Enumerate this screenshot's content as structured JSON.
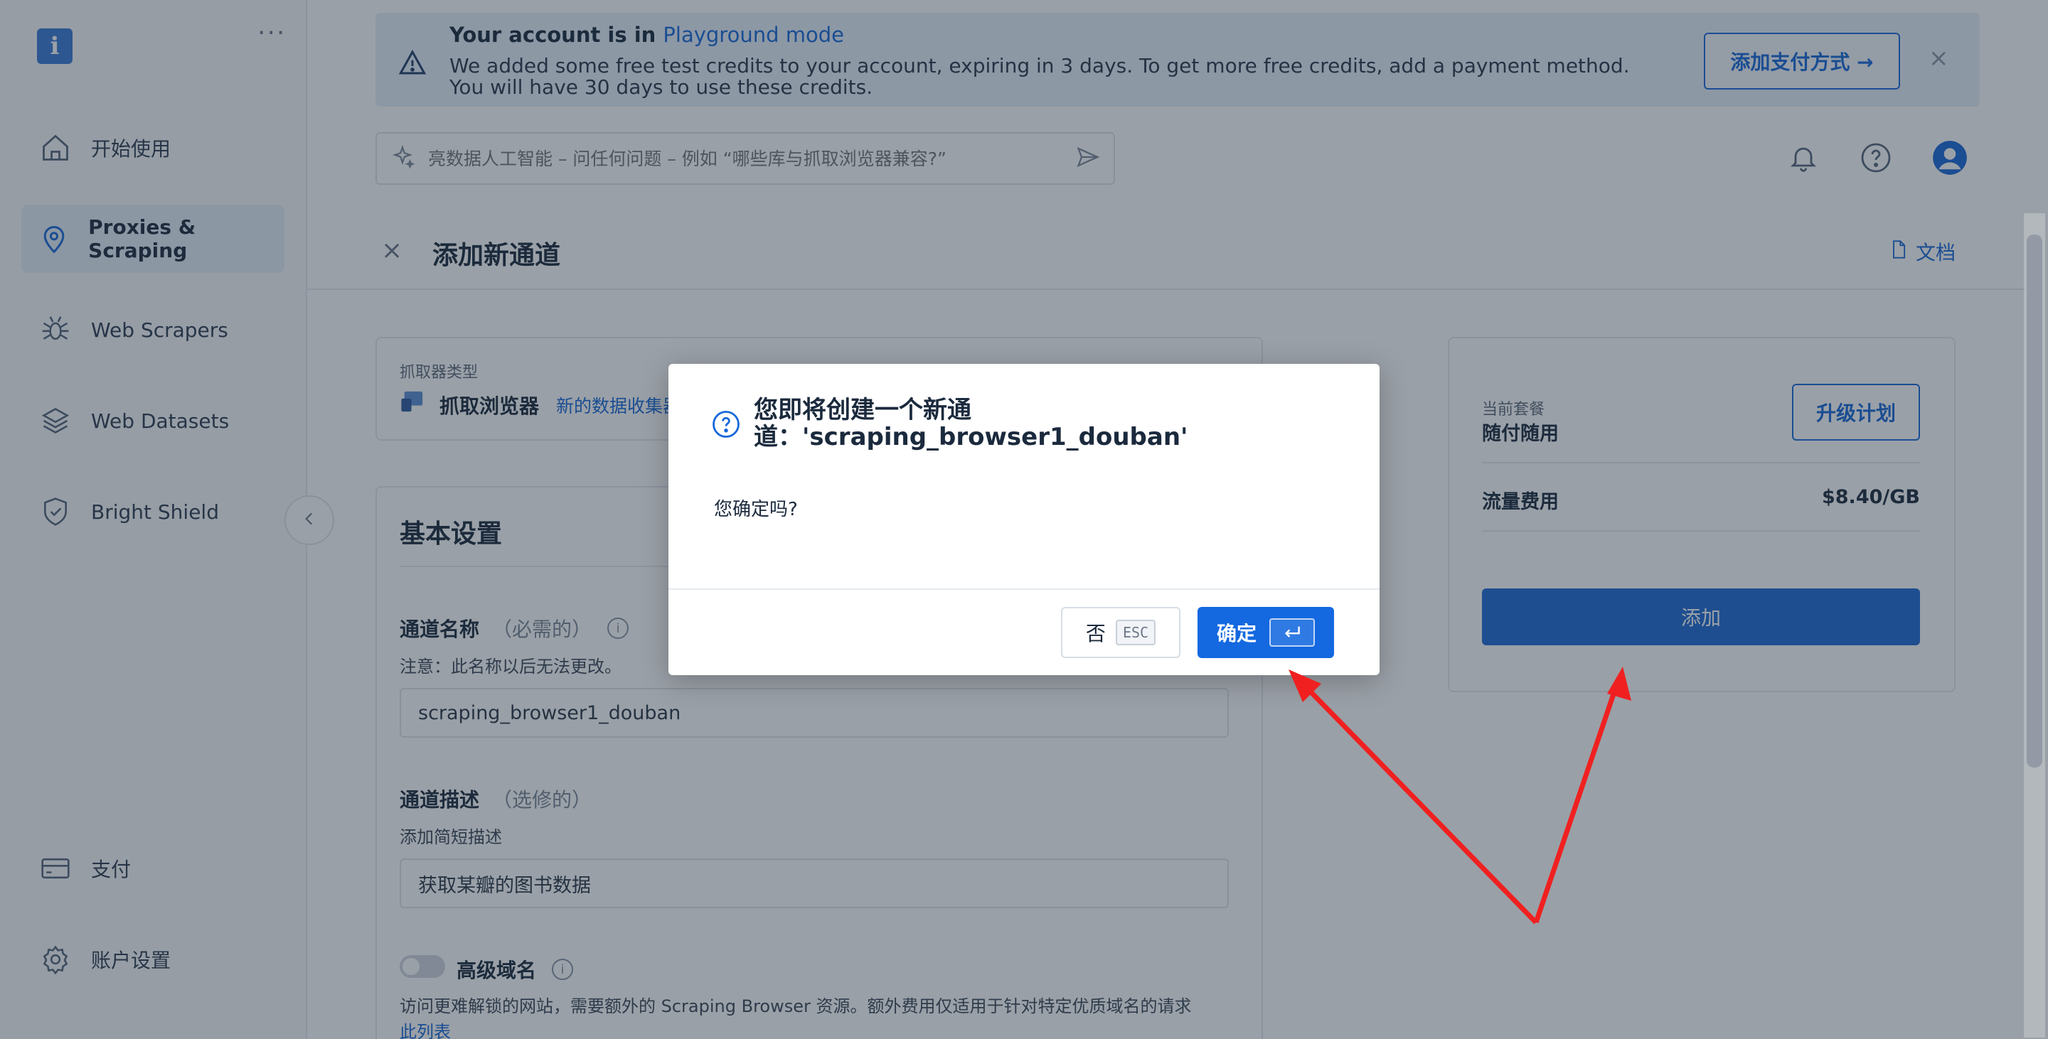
{
  "sidebar": {
    "logo": "i",
    "more": "···",
    "items": [
      {
        "label": "开始使用",
        "icon": "home-icon"
      },
      {
        "label": "Proxies & Scraping",
        "icon": "location-pin-icon"
      },
      {
        "label": "Web Scrapers",
        "icon": "spider-icon"
      },
      {
        "label": "Web Datasets",
        "icon": "layers-icon"
      },
      {
        "label": "Bright Shield",
        "icon": "shield-check-icon"
      }
    ],
    "bottom_items": [
      {
        "label": "支付",
        "icon": "credit-card-icon"
      },
      {
        "label": "账户设置",
        "icon": "gear-icon"
      }
    ]
  },
  "banner": {
    "title_prefix": "Your account is in ",
    "title_link": "Playground mode",
    "text": "We added some free test credits to your account, expiring in 3 days. To get more free credits, add a payment method. You will have 30 days to use these credits.",
    "button": "添加支付方式 →",
    "close": "×"
  },
  "search": {
    "placeholder": "亮数据人工智能 – 问任何问题 – 例如 “哪些库与抓取浏览器兼容?”"
  },
  "page": {
    "title": "添加新通道",
    "close": "×",
    "docs": "文档"
  },
  "form": {
    "scraper_type_label": "抓取器类型",
    "scraper_type_value": "抓取浏览器",
    "scraper_type_link": "新的数据收集器",
    "basic_settings": "基本设置",
    "name_label": "通道名称",
    "name_opt": "（必需的）",
    "name_hint": "注意：此名称以后无法更改。",
    "name_value": "scraping_browser1_douban",
    "desc_label": "通道描述",
    "desc_opt": "（选修的）",
    "desc_hint": "添加简短描述",
    "desc_value": "获取某瓣的图书数据",
    "premium_label": "高级域名",
    "premium_hint": "访问更难解锁的网站，需要额外的 Scraping Browser 资源。额外费用仅适用于针对特定优质域名的请求",
    "premium_link": "此列表"
  },
  "plan": {
    "current_label": "当前套餐",
    "current_value": "随付随用",
    "upgrade": "升级计划",
    "traffic_label": "流量费用",
    "traffic_value": "$8.40/GB",
    "add": "添加"
  },
  "modal": {
    "title": "您即将创建一个新通道：'scraping_browser1_douban'",
    "body": "您确定吗?",
    "no": "否",
    "no_key": "ESC",
    "yes": "确定"
  },
  "colors": {
    "accent": "#1468e0",
    "annotation_arrow": "#f02020"
  }
}
